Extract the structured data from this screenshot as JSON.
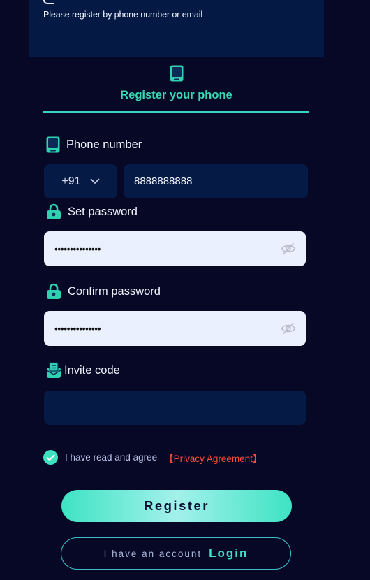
{
  "banner": {
    "text": "Please register by phone number or email"
  },
  "tab": {
    "label": "Register your phone"
  },
  "phone": {
    "label": "Phone number",
    "country_code": "+91",
    "value": "8888888888"
  },
  "password": {
    "label": "Set password",
    "value": "•••••••••••••••"
  },
  "confirm": {
    "label": "Confirm password",
    "value": "•••••••••••••••"
  },
  "invite": {
    "label": "Invite code",
    "value": ""
  },
  "agreement": {
    "text": "I have read and agree",
    "link": "【Privacy Agreement】",
    "checked": true
  },
  "buttons": {
    "register": "Register",
    "login_prefix": "I have an account",
    "login": "Login"
  },
  "colors": {
    "background": "#070726",
    "accent": "#3ee3c4",
    "input_dark": "#051a44",
    "input_light": "#eaf0fd",
    "link_red": "#ff4d3a"
  }
}
